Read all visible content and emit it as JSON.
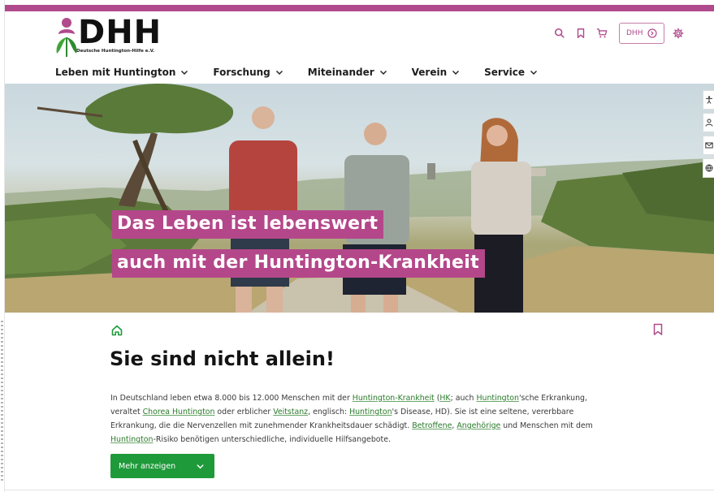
{
  "brand": {
    "logo_text": "DHH",
    "logo_subtitle": "Deutsche Huntington-Hilfe e.V.",
    "accent_color": "#b04a8c",
    "green_color": "#1f9a3a"
  },
  "header": {
    "icons": [
      "search-icon",
      "bookmark-icon",
      "cart-icon"
    ],
    "account_button_label": "DHH",
    "settings_icon": "gear-icon"
  },
  "nav": {
    "items": [
      {
        "label": "Leben mit Huntington"
      },
      {
        "label": "Forschung"
      },
      {
        "label": "Miteinander"
      },
      {
        "label": "Verein"
      },
      {
        "label": "Service"
      }
    ]
  },
  "hero": {
    "line1": "Das Leben ist lebenswert",
    "line2": "auch mit der Huntington-Krankheit"
  },
  "side_tools": [
    "accessibility-icon",
    "person-icon",
    "mail-icon",
    "globe-icon"
  ],
  "main": {
    "title": "Sie sind nicht allein!",
    "intro": {
      "t1": "In Deutschland leben etwa 8.000 bis 12.000 Menschen mit der ",
      "l1": "Huntington-Krankheit",
      "t2": " (",
      "l2": "HK",
      "t3": "; auch ",
      "l3": "Huntington",
      "t4": "'sche Erkrankung, veraltet ",
      "l4": "Chorea Huntington",
      "t5": " oder erblicher ",
      "l5": "Veitstanz",
      "t6": ", englisch: ",
      "l6": "Huntington",
      "t7": "'s Disease, HD). Sie ist eine seltene, vererbbare Erkrankung, die die Nervenzellen mit zunehmender Krankheitsdauer schädigt. ",
      "l7": "Betroffene",
      "t8": ", ",
      "l8": "Angehörige",
      "t9": " und Menschen mit dem ",
      "l9": "Huntington",
      "t10": "-Risiko benötigen unterschiedliche, individuelle Hilfsangebote."
    },
    "more_button_label": "Mehr anzeigen"
  }
}
